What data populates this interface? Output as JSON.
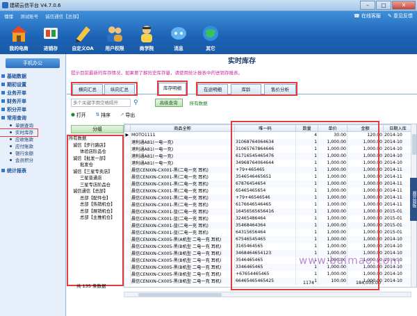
{
  "window": {
    "title": "建硕云信平台 V4.7.0.6"
  },
  "header": {
    "user": "懂懂",
    "acct": "测试账号",
    "org": "诚信通信【总部】",
    "online_service": "在线客服",
    "feedback": "意见反馈",
    "tools": [
      {
        "label": "我的电商",
        "icon": "home-icon"
      },
      {
        "label": "进销存",
        "icon": "cart-icon"
      },
      {
        "label": "自定义OA",
        "icon": "pencil-icon"
      },
      {
        "label": "用户权限",
        "icon": "users-icon"
      },
      {
        "label": "商学院",
        "icon": "teacher-icon"
      },
      {
        "label": "消息",
        "icon": "message-icon"
      },
      {
        "label": "其它",
        "icon": "globe-icon"
      }
    ]
  },
  "sidebar": {
    "title": "手机办公",
    "groups": [
      {
        "label": "基础数据"
      },
      {
        "label": "期初设置"
      },
      {
        "label": "业务开单"
      },
      {
        "label": "财务开单"
      },
      {
        "label": "积分开单"
      },
      {
        "label": "常用查询"
      }
    ],
    "subs": [
      "单据查询",
      "实时库存",
      "应收账款",
      "应付账款",
      "银行余额",
      "会员积分"
    ],
    "last": "统计报表"
  },
  "main": {
    "title": "实时库存",
    "notice": "提示目前最新的库存情况，如果要了解历史库存量，请使用统计报表中的进销存报表。",
    "tabs": [
      "横向汇总",
      "纵向汇总",
      "库存明细",
      "在途明细",
      "库龄",
      "售价分析"
    ],
    "search_placeholder": "多个关键字用空格隔开",
    "adv_search": "高级查询",
    "all_data": "所有数据",
    "actions": {
      "open": "打开",
      "sort": "排序",
      "export": "导出"
    },
    "group_btn": "分组",
    "tree": [
      "所有数据",
      "诚信【步行路店】",
      "体验店阶品仓",
      "诚信【批发一部】",
      "批发仓",
      "诚信【三星专卖店】",
      "三星普通店",
      "三星专店阶品仓",
      "诚信通信【总部】",
      "总部【配件仓】",
      "总部【热销机仓】",
      "总部【展销机仓】",
      "总部【主推机仓】"
    ],
    "count": "共 135 条数据",
    "cols": [
      "",
      "商品全称",
      "唯一码",
      "数量",
      "单价",
      "金额",
      "日期入库"
    ],
    "rows": [
      [
        "▶",
        "MOTO1111",
        "",
        "4",
        "30.00",
        "120.00",
        "2014-10"
      ],
      [
        "",
        "港利通A81(一电一充)",
        "31068764064634",
        "1",
        "1,000.00",
        "1,000.00",
        "2014-10"
      ],
      [
        "",
        "港利通A81(一电一充)",
        "31065767864646",
        "1",
        "1,000.00",
        "1,000.00",
        "2014-10"
      ],
      [
        "",
        "港利通A81(一电一充)",
        "61716545465476",
        "1",
        "1,000.00",
        "1,000.00",
        "2014-10"
      ],
      [
        "",
        "港利通A81(一电一充)",
        "34968764064644",
        "1",
        "1,000.00",
        "1,000.00",
        "2014-10"
      ],
      [
        "",
        "晨信CENXIN-CX001-黑(二电一充 耳机)",
        "+79+465465",
        "1",
        "1,000.00",
        "1,000.00",
        "2014-11"
      ],
      [
        "",
        "晨信CENXIN-CX001-黑(二电一充 耳机)",
        "35465464656S1",
        "1",
        "1,000.00",
        "1,000.00",
        "2014-11"
      ],
      [
        "",
        "晨信CENXIN-CX001-黑(二电一充 耳机)",
        "67876454654",
        "1",
        "1,000.00",
        "1,000.00",
        "2014-11"
      ],
      [
        "",
        "晨信CENXIN-CX001-黑(二电一充 耳机)",
        "65465465654",
        "1",
        "1,000.00",
        "1,000.00",
        "2014-11"
      ],
      [
        "",
        "晨信CENXIN-CX001-黑(二电一充 耳机)",
        "+79+46546546",
        "1",
        "1,000.00",
        "1,000.00",
        "2014-11"
      ],
      [
        "",
        "晨信CENXIN-CX001-黑(二电一充 耳机)",
        "6176646546465",
        "1",
        "1,000.00",
        "1,000.00",
        "2014-11"
      ],
      [
        "",
        "晨信CENXIN-CX001-蓝(二电一充 耳机)",
        "16456565656416",
        "1",
        "1,000.00",
        "1,000.00",
        "2015-01"
      ],
      [
        "",
        "晨信CENXIN-CX001-蓝(二电一充 耳机)",
        "32465486464",
        "1",
        "1,000.00",
        "1,000.00",
        "2015-01"
      ],
      [
        "",
        "晨信CENXIN-CX001-蓝(二电一充 耳机)",
        "35468464364",
        "1",
        "1,000.00",
        "1,000.00",
        "2015-01"
      ],
      [
        "",
        "晨信CENXIN-CX001-蓝(二电一充 耳机)",
        "64315656464",
        "1",
        "1,000.00",
        "1,000.00",
        "2015-01"
      ],
      [
        "",
        "晨信CENXIN-CX005-黑(A机型 二电一充 耳机)",
        "67546545465",
        "1",
        "1,000.00",
        "1,000.00",
        "2014-10"
      ],
      [
        "",
        "晨信CENXIN-CX005-黑(B机型 二电一充 耳机)",
        "3165464565",
        "1",
        "1,000.00",
        "1,000.00",
        "2014-10"
      ],
      [
        "",
        "晨信CENXIN-CX005-黑(B机型 二电一充 耳机)",
        "3468464654123",
        "1",
        "1,000.00",
        "1,000.00",
        "2014-10"
      ],
      [
        "",
        "晨信CENXIN-CX005-黑(B机型 二电一充 耳机)",
        "3546465465",
        "1",
        "1,000.00",
        "1,000.00",
        "2014-10"
      ],
      [
        "",
        "晨信CENXIN-CX005-黑(B机型 二电一充 耳机)",
        "3346465465",
        "1",
        "1,000.00",
        "1,000.00",
        "2014-10"
      ],
      [
        "",
        "晨信CENXIN-CX005-黑(B机型 二电一充 耳机)",
        "+67654465465",
        "1",
        "1,000.00",
        "1,000.00",
        "2014-10"
      ],
      [
        "",
        "晨信CENXIN-CX005-黑(B机型 二电一充 耳机)",
        "66465465465425",
        "1",
        "100.00",
        "1,000.00",
        "2014-10"
      ]
    ],
    "total_qty": "1174",
    "total_amount": "184,035.00"
  },
  "side_panel": "展开面板",
  "watermark": "www.baimao.com"
}
